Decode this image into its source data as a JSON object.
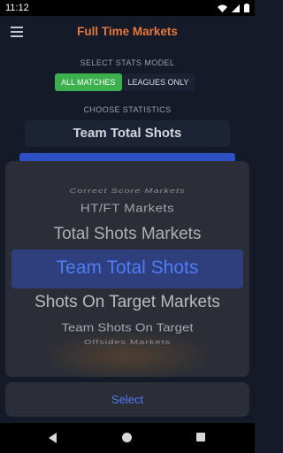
{
  "status_bar": {
    "time": "11:12"
  },
  "header": {
    "title": "Full Time Markets"
  },
  "stats_model": {
    "label": "SELECT STATS MODEL",
    "options": [
      "ALL MATCHES",
      "LEAGUES ONLY"
    ],
    "selected": "ALL MATCHES"
  },
  "statistics": {
    "label": "CHOOSE STATISTICS",
    "selected": "Team Total Shots"
  },
  "picker": {
    "items": [
      "Correct Score Markets",
      "HT/FT Markets",
      "Total Shots Markets",
      "Team Total Shots",
      "Shots On Target Markets",
      "Team Shots On Target",
      "Offsides Markets"
    ],
    "selected_index": 3,
    "colors": {
      "selected_text": "#4d7df5",
      "selected_band": "#2f3e7c",
      "sheet": "#2b2e36"
    }
  },
  "actions": {
    "select_label": "Select"
  },
  "colors": {
    "accent_orange": "#e7783a",
    "toggle_green": "#3bb04d",
    "background": "#141a28"
  }
}
